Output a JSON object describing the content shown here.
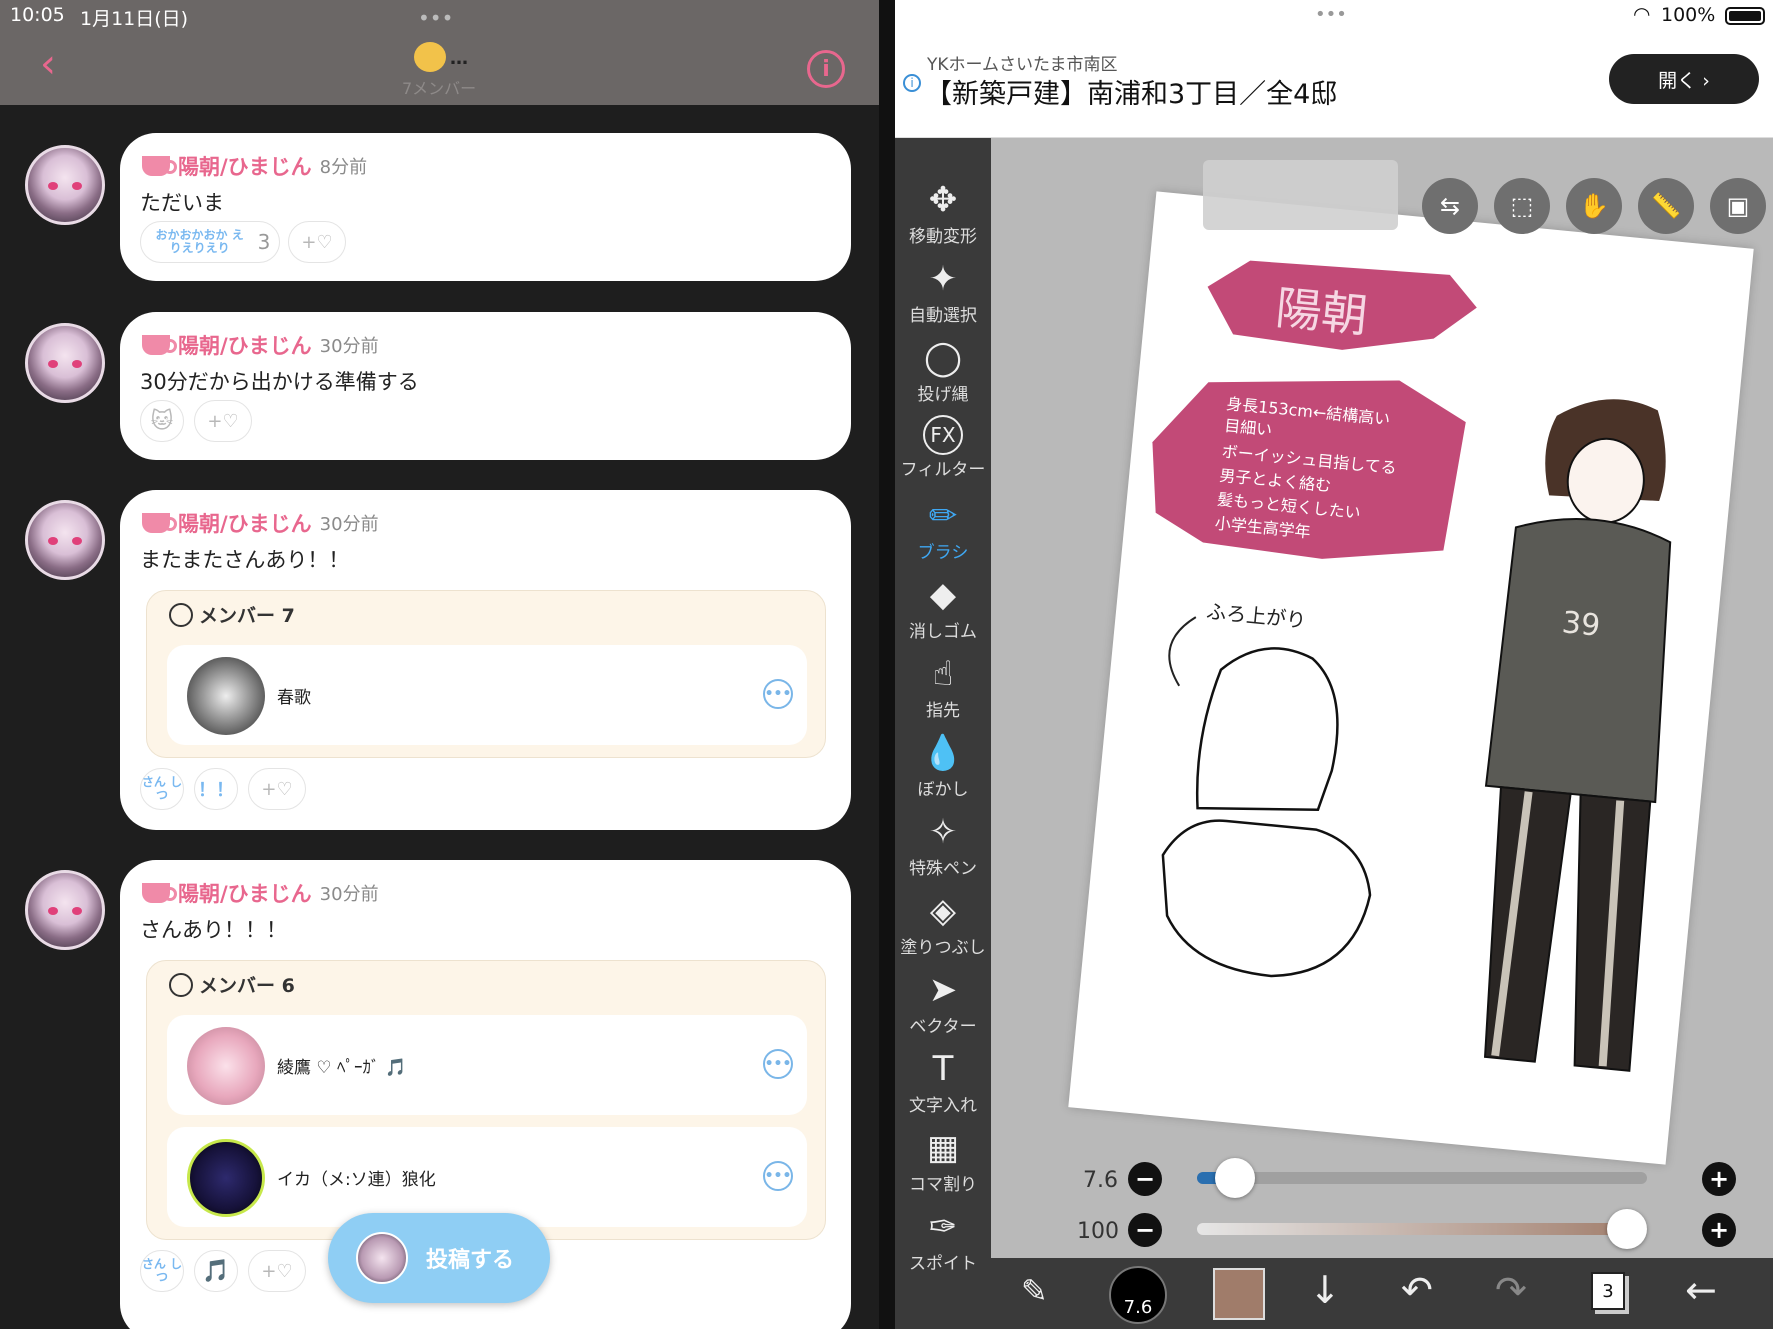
{
  "status": {
    "time": "10:05",
    "date": "1月11日(日)",
    "battery": "100%"
  },
  "chat": {
    "header": {
      "title_suffix": "…",
      "members": "7メンバー"
    },
    "messages": [
      {
        "user": "陽朝/ひまじん",
        "time": "8分前",
        "text": "ただいま",
        "stamp": "おかおかおか えりえりえり",
        "stamp_count": "3",
        "add_reaction": "+♡"
      },
      {
        "user": "陽朝/ひまじん",
        "time": "30分前",
        "text": "30分だから出かける準備する",
        "stamp": "🐱",
        "add_reaction": "+♡"
      },
      {
        "user": "陽朝/ひまじん",
        "time": "30分前",
        "text": "またまたさんあり！！",
        "card_title": "メンバー 7",
        "members": [
          {
            "name": "春歌"
          }
        ],
        "stamp": "さん しつ",
        "stamp2": "！！",
        "add_reaction": "+♡"
      },
      {
        "user": "陽朝/ひまじん",
        "time": "30分前",
        "text": "さんあり！！！",
        "card_title": "メンバー 6",
        "members": [
          {
            "name": "綾鷹 ♡ ﾍﾟｰｶﾞ 🎵"
          },
          {
            "name": "イカ（メ:ソ連）狼化"
          }
        ],
        "stamp": "さん しつ",
        "stamp2": "🎵",
        "add_reaction": "+♡"
      }
    ],
    "post_button": "投稿する"
  },
  "ad": {
    "advertiser": "YKホームさいたま市南区",
    "title": "【新築戸建】南浦和3丁目／全4邸",
    "open": "開く ›"
  },
  "tools": [
    {
      "label": "移動変形",
      "icon": "move-icon"
    },
    {
      "label": "自動選択",
      "icon": "magic-wand-icon"
    },
    {
      "label": "投げ縄",
      "icon": "lasso-icon"
    },
    {
      "label": "フィルター",
      "icon": "fx-icon"
    },
    {
      "label": "ブラシ",
      "icon": "brush-icon",
      "active": true
    },
    {
      "label": "消しゴム",
      "icon": "eraser-icon"
    },
    {
      "label": "指先",
      "icon": "finger-icon"
    },
    {
      "label": "ぼかし",
      "icon": "blur-icon"
    },
    {
      "label": "特殊ペン",
      "icon": "special-pen-icon"
    },
    {
      "label": "塗りつぶし",
      "icon": "fill-icon"
    },
    {
      "label": "ベクター",
      "icon": "vector-icon"
    },
    {
      "label": "文字入れ",
      "icon": "text-icon"
    },
    {
      "label": "コマ割り",
      "icon": "frame-icon"
    },
    {
      "label": "スポイト",
      "icon": "eyedropper-icon"
    }
  ],
  "drawing": {
    "name_banner": "陽朝",
    "notes": [
      "身長153cm←結構高い",
      "目細い",
      "ボーイッシュ目指してる",
      "男子とよく絡む",
      "髪もっと短くしたい",
      "小学生高学年"
    ],
    "caption": "ふろ上がり"
  },
  "sliders": {
    "size_label": "7.6",
    "size_value": 0.04,
    "opacity_label": "100",
    "opacity_value": 1.0
  },
  "bottom": {
    "brush_size": "7.6",
    "color": "#a07c6a",
    "layers": "3"
  }
}
